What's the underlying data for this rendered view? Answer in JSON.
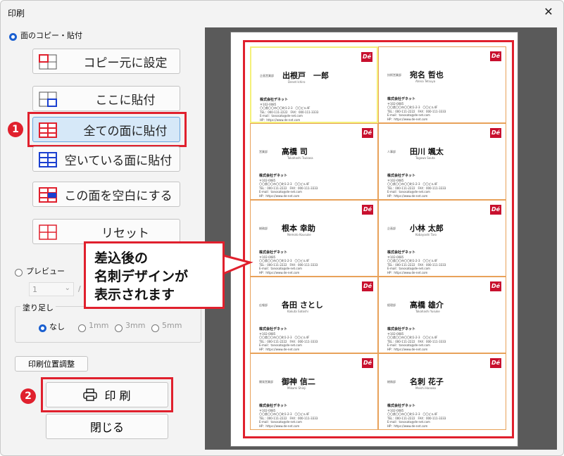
{
  "window": {
    "title": "印刷",
    "close_glyph": "✕"
  },
  "face_copy": {
    "label": "面のコピー・貼付"
  },
  "buttons": {
    "set_source": "コピー元に設定",
    "paste_here": "ここに貼付",
    "paste_all": "全ての面に貼付",
    "paste_empty": "空いている面に貼付",
    "clear_face": "この面を空白にする",
    "reset": "リセット"
  },
  "preview": {
    "label": "プレビュー",
    "page_value": "1",
    "page_sep": "/"
  },
  "bleed": {
    "title": "塗り足し",
    "options": [
      "なし",
      "1mm",
      "3mm",
      "5mm"
    ],
    "selected": "なし"
  },
  "print_position_button": "印刷位置調整",
  "print_button": "印 刷",
  "close_button": "閉じる",
  "steps": [
    "1",
    "2"
  ],
  "callout": {
    "lines": [
      "差込後の",
      "名刺デザインが",
      "表示されます"
    ]
  },
  "cards": [
    {
      "role": "企画営業部",
      "name": "出根戸　一郎",
      "roman": "Denet Ichiro"
    },
    {
      "role": "技術営業部",
      "name": "宛名 哲也",
      "roman": "Atena Tetsuya"
    },
    {
      "role": "営業部",
      "name": "高橋 司",
      "roman": "Takahashi Tsukasa"
    },
    {
      "role": "人事部",
      "name": "田川 颯太",
      "roman": "Tagawa Souta"
    },
    {
      "role": "総務部",
      "name": "根本 幸助",
      "roman": "Nemoto Kousuke"
    },
    {
      "role": "企画部",
      "name": "小林 太郎",
      "roman": "Kobayashi Taro"
    },
    {
      "role": "広報部",
      "name": "各田 さとし",
      "roman": "Kakuta Satoshi"
    },
    {
      "role": "経理部",
      "name": "高橋 雄介",
      "roman": "Takahashi Yusuke"
    },
    {
      "role": "開発営業部",
      "name": "御神 信二",
      "roman": "Mikami Shinji"
    },
    {
      "role": "総務部",
      "name": "名刺 花子",
      "roman": "Meishi Hanako"
    }
  ],
  "card_common": {
    "logo": "Dé",
    "company": "株式会社デネット",
    "address_lines": [
      "〒102-0085",
      "〇〇県〇〇市〇〇町1-2-3　〇〇ビル4F",
      "TEL：000-111-2222　FAX：000-111-3333",
      "E-mail：tanosato@de-net.com",
      "HP：https://www.de-net.com"
    ]
  },
  "colors": {
    "accent_red": "#e0202d",
    "radio_blue": "#1a5fd0",
    "card_border": "#e8a25a",
    "source_highlight": "#f4f07a"
  }
}
